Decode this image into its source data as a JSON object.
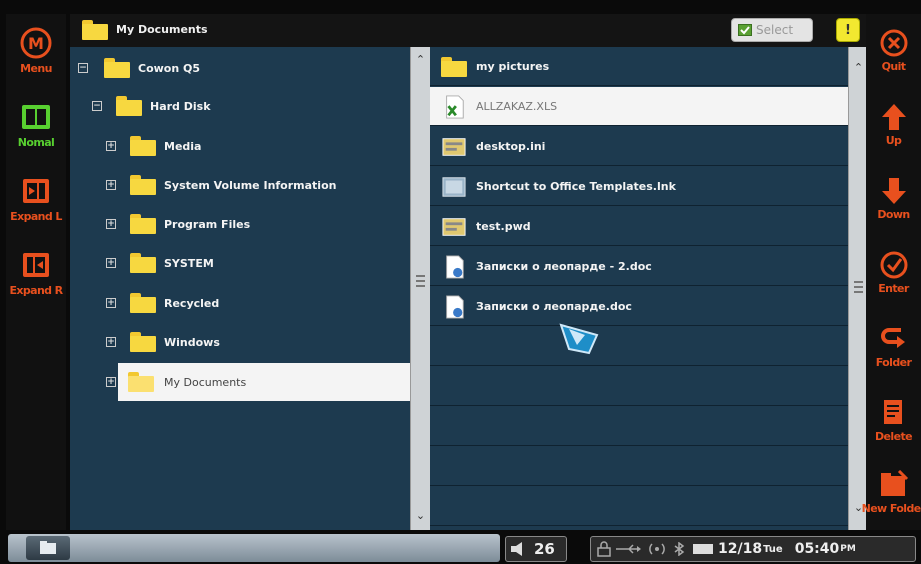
{
  "colors": {
    "accent_orange": "#e8501e",
    "accent_green": "#58d030",
    "pane_bg": "#1d3a4f",
    "selection_bg": "#f4f4f4",
    "folder_yellow": "#f7d840"
  },
  "title_bar": {
    "title": "My Documents",
    "select_label": "Select",
    "info_label": "!"
  },
  "left_toolbar": [
    {
      "label": "Menu",
      "icon": "menu-circle-m-icon"
    },
    {
      "label": "Nomal",
      "icon": "normal-view-icon"
    },
    {
      "label": "Expand L",
      "icon": "expand-left-icon"
    },
    {
      "label": "Expand R",
      "icon": "expand-right-icon"
    }
  ],
  "right_toolbar": [
    {
      "label": "Quit",
      "icon": "quit-x-icon"
    },
    {
      "label": "Up",
      "icon": "arrow-up-icon"
    },
    {
      "label": "Down",
      "icon": "arrow-down-icon"
    },
    {
      "label": "Enter",
      "icon": "enter-check-icon"
    },
    {
      "label": "Folder",
      "icon": "folder-back-icon"
    },
    {
      "label": "Delete",
      "icon": "delete-doc-icon"
    },
    {
      "label": "New Folder",
      "icon": "new-folder-icon"
    }
  ],
  "tree": [
    {
      "label": "Cowon Q5",
      "expander": "⊟",
      "level": 0
    },
    {
      "label": "Hard Disk",
      "expander": "⊟",
      "level": 1
    },
    {
      "label": "Media",
      "expander": "⊞",
      "level": 2
    },
    {
      "label": "System Volume Information",
      "expander": "⊞",
      "level": 2
    },
    {
      "label": "Program Files",
      "expander": "⊞",
      "level": 2
    },
    {
      "label": "SYSTEM",
      "expander": "⊞",
      "level": 2
    },
    {
      "label": "Recycled",
      "expander": "⊞",
      "level": 2
    },
    {
      "label": "Windows",
      "expander": "⊞",
      "level": 2
    },
    {
      "label": "My Documents",
      "expander": "⊞",
      "level": 2,
      "selected": true
    }
  ],
  "files": [
    {
      "name": "my pictures",
      "type": "folder"
    },
    {
      "name": "ALLZAKAZ.XLS",
      "type": "excel",
      "selected": true
    },
    {
      "name": "desktop.ini",
      "type": "ini"
    },
    {
      "name": "Shortcut to Office Templates.lnk",
      "type": "shortcut"
    },
    {
      "name": "test.pwd",
      "type": "ini"
    },
    {
      "name": "Записки о леопарде - 2.doc",
      "type": "doc"
    },
    {
      "name": "Записки о леопарде.doc",
      "type": "doc"
    }
  ],
  "status_bar": {
    "volume": "26",
    "date": "12/18",
    "day": "Tue",
    "time": "05:40",
    "ampm": "PM"
  }
}
